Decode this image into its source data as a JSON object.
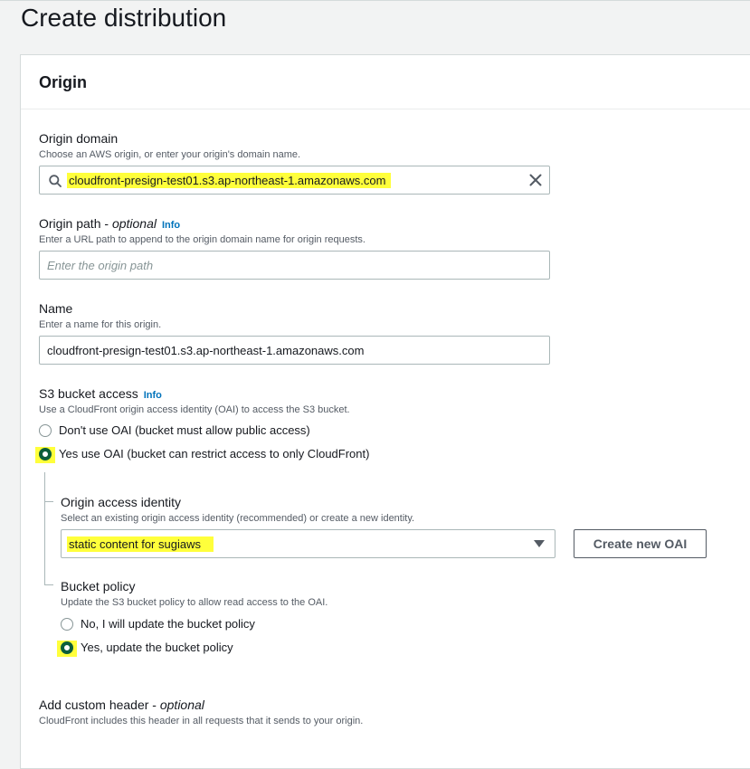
{
  "page": {
    "title": "Create distribution"
  },
  "origin": {
    "section_title": "Origin",
    "domain": {
      "label": "Origin domain",
      "description": "Choose an AWS origin, or enter your origin's domain name.",
      "value": "cloudfront-presign-test01.s3.ap-northeast-1.amazonaws.com"
    },
    "path": {
      "label": "Origin path - ",
      "optional": "optional",
      "info": "Info",
      "description": "Enter a URL path to append to the origin domain name for origin requests.",
      "placeholder": "Enter the origin path"
    },
    "name": {
      "label": "Name",
      "description": "Enter a name for this origin.",
      "value": "cloudfront-presign-test01.s3.ap-northeast-1.amazonaws.com"
    },
    "s3_access": {
      "label": "S3 bucket access",
      "info": "Info",
      "description": "Use a CloudFront origin access identity (OAI) to access the S3 bucket.",
      "options": [
        {
          "label": "Don't use OAI (bucket must allow public access)",
          "selected": false
        },
        {
          "label": "Yes use OAI (bucket can restrict access to only CloudFront)",
          "selected": true
        }
      ]
    },
    "oai": {
      "label": "Origin access identity",
      "description": "Select an existing origin access identity (recommended) or create a new identity.",
      "selected": "static content for sugiaws",
      "create_button": "Create new OAI"
    },
    "bucket_policy": {
      "label": "Bucket policy",
      "description": "Update the S3 bucket policy to allow read access to the OAI.",
      "options": [
        {
          "label": "No, I will update the bucket policy",
          "selected": false
        },
        {
          "label": "Yes, update the bucket policy",
          "selected": true
        }
      ]
    },
    "custom_header": {
      "label": "Add custom header - ",
      "optional": "optional",
      "description": "CloudFront includes this header in all requests that it sends to your origin."
    }
  },
  "colors": {
    "highlight": "#ffff3b",
    "link": "#0073bb",
    "radio_selected": "#0b5e3b"
  }
}
